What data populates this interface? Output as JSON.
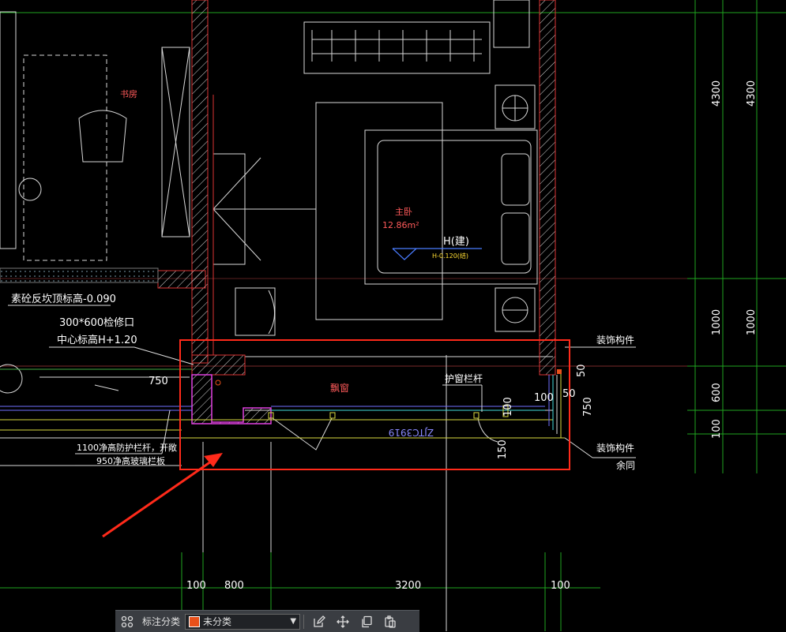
{
  "drawing": {
    "room_study": "书房",
    "room_master": "主卧",
    "room_master_area": "12.86m²",
    "level_mark": "H(建)",
    "level_sub": "H-0.120(结)",
    "note_floor": "素砼反坎顶标高-0.090",
    "note_access_1": "300*600检修口",
    "note_access_2": "中心标高H+1.20",
    "note_bay": "飘窗",
    "note_guardrail": "护窗栏杆",
    "note_deco_top": "装饰构件",
    "note_deco_bottom": "装饰构件",
    "note_same": "余同",
    "note_rail_1": "1100净高防护栏杆，开敞",
    "note_rail_2": "950净高玻璃栏板",
    "window_code": "ZJTC3919",
    "dims": {
      "d750": "750",
      "d100a": "100",
      "d50a": "50",
      "d50b": "50",
      "d750b": "750",
      "d100b": "100",
      "d150": "150",
      "r4300a": "4300",
      "r4300b": "4300",
      "r1000a": "1000",
      "r1000b": "1000",
      "r600": "600",
      "r100": "100",
      "b100a": "100",
      "b800": "800",
      "b3200": "3200",
      "b100b": "100"
    }
  },
  "toolbar": {
    "category_label": "标注分类",
    "category_value": "未分类",
    "swatch_color": "#e8501a",
    "icons": [
      "grid-icon",
      "edit-icon",
      "move-icon",
      "copy-icon",
      "paste-icon"
    ]
  }
}
